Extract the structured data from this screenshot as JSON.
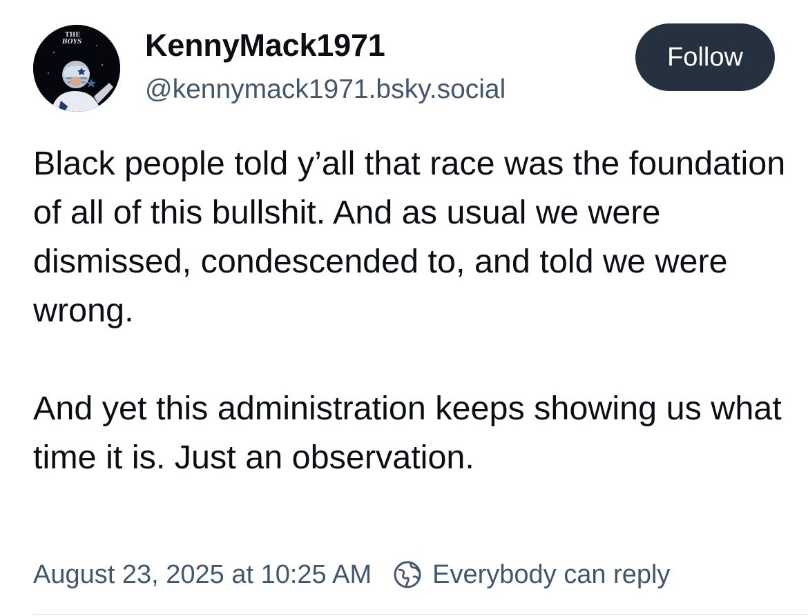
{
  "author": {
    "display_name": "KennyMack1971",
    "handle": "@kennymack1971.bsky.social",
    "avatar_icon": "profile-avatar",
    "avatar_text_line1": "THE",
    "avatar_text_line2": "BOYS"
  },
  "follow_button": {
    "label": "Follow"
  },
  "post": {
    "paragraphs": [
      "Black people told y’all that race was the foundation of all of this bullshit. And as usual we were dismissed, condescended to, and told we were wrong.",
      "And yet this administration keeps showing us what time it is. Just an observation."
    ]
  },
  "meta": {
    "timestamp": "August 23, 2025 at 10:25 AM",
    "reply_icon": "globe-icon",
    "reply_setting": "Everybody can reply"
  },
  "colors": {
    "text": "#0b0f14",
    "muted": "#42576c",
    "button_bg": "#25313f",
    "button_text": "#ffffff",
    "divider": "#d9e0e7"
  }
}
